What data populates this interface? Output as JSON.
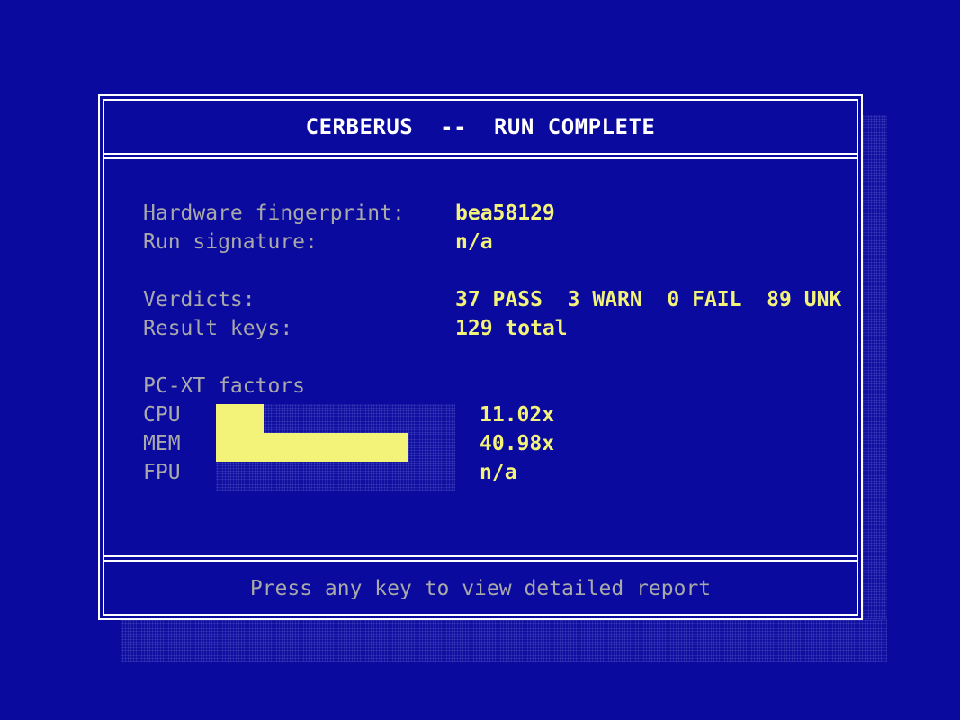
{
  "header": {
    "title": "CERBERUS  --  RUN COMPLETE"
  },
  "info": {
    "hw_label": "Hardware fingerprint:",
    "hw_value": "bea58129",
    "sig_label": "Run signature:",
    "sig_value": "n/a",
    "verdicts_label": "Verdicts:",
    "verdicts_value": "37 PASS  3 WARN  0 FAIL  89 UNK",
    "keys_label": "Result keys:",
    "keys_value": "129 total"
  },
  "factors": {
    "heading": "PC-XT factors",
    "items": [
      {
        "label": "CPU",
        "value": "11.02x",
        "fill_fraction": 0.2
      },
      {
        "label": "MEM",
        "value": "40.98x",
        "fill_fraction": 0.8
      },
      {
        "label": "FPU",
        "value": "n/a",
        "fill_fraction": 0
      }
    ]
  },
  "footer": {
    "prompt": "Press any key to view detailed report"
  },
  "colors": {
    "background": "#0a0a9e",
    "frame": "#ffffff",
    "label": "#a9a9a9",
    "value": "#f3f37a",
    "bar": "#f3f37a"
  }
}
